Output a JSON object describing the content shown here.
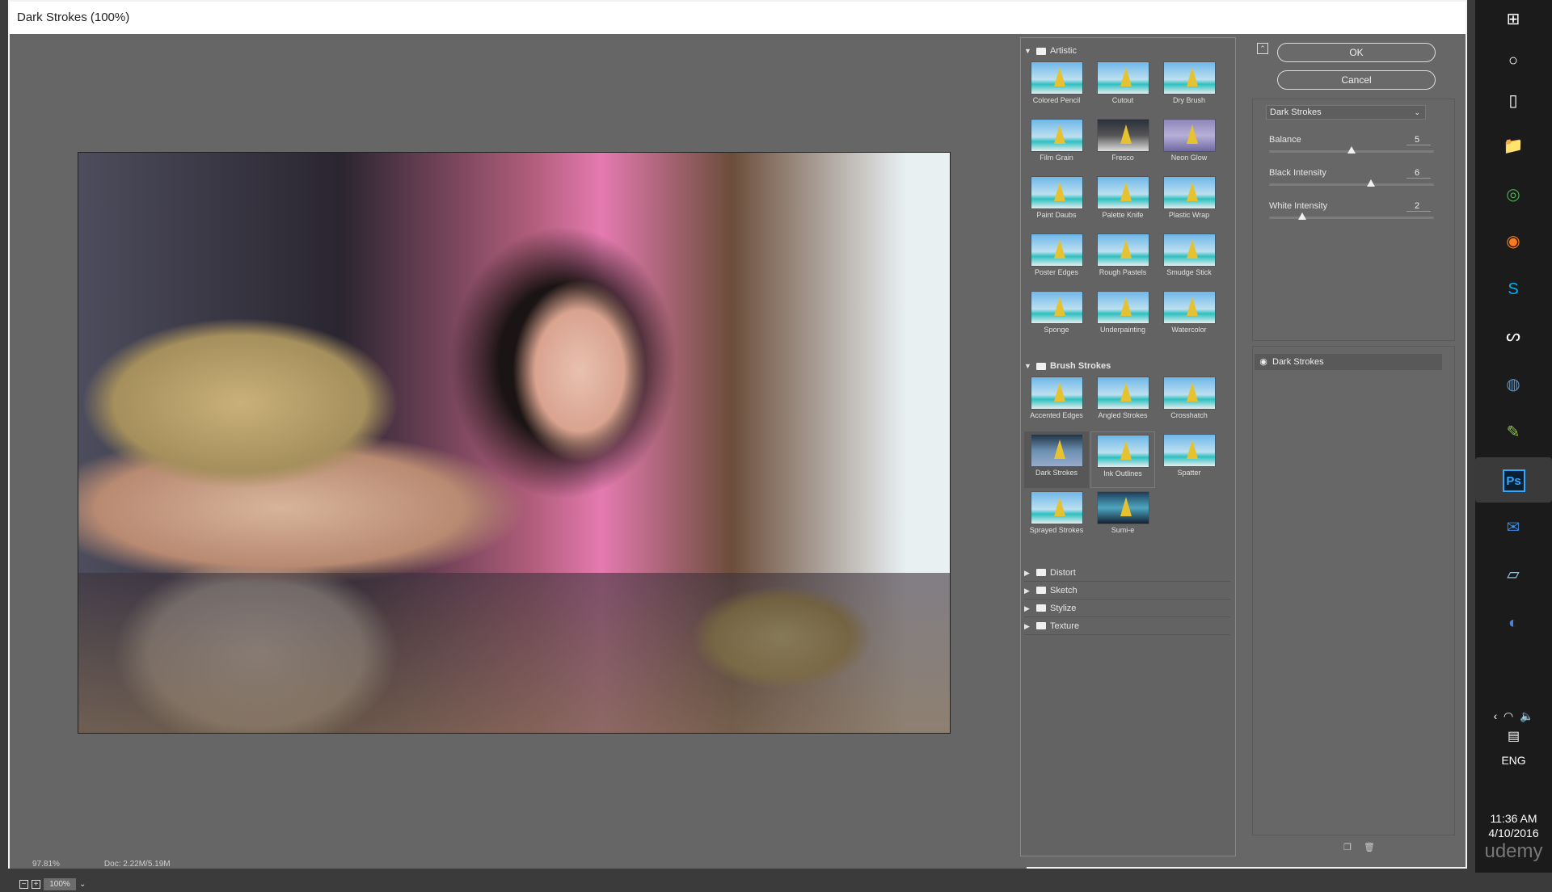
{
  "dialog": {
    "title": "Dark Strokes (100%)"
  },
  "preview": {
    "zoom": "100%",
    "zoom_out": "−",
    "zoom_in": "+",
    "chevron": "⌄"
  },
  "statusbar": {
    "zoom": "97.81%",
    "doc": "Doc: 2.22M/5.19M"
  },
  "gallery": {
    "categories": [
      {
        "name": "Artistic",
        "expanded": true,
        "filters": [
          "Colored Pencil",
          "Cutout",
          "Dry Brush",
          "Film Grain",
          "Fresco",
          "Neon Glow",
          "Paint Daubs",
          "Palette Knife",
          "Plastic Wrap",
          "Poster Edges",
          "Rough Pastels",
          "Smudge Stick",
          "Sponge",
          "Underpainting",
          "Watercolor"
        ]
      },
      {
        "name": "Brush Strokes",
        "expanded": true,
        "filters": [
          "Accented Edges",
          "Angled Strokes",
          "Crosshatch",
          "Dark Strokes",
          "Ink Outlines",
          "Spatter",
          "Sprayed Strokes",
          "Sumi-e"
        ]
      },
      {
        "name": "Distort",
        "expanded": false
      },
      {
        "name": "Sketch",
        "expanded": false
      },
      {
        "name": "Stylize",
        "expanded": false
      },
      {
        "name": "Texture",
        "expanded": false
      }
    ],
    "selected_filter": "Dark Strokes"
  },
  "buttons": {
    "ok": "OK",
    "cancel": "Cancel"
  },
  "settings": {
    "filter": "Dark Strokes",
    "params": [
      {
        "label": "Balance",
        "value": "5",
        "min": 0,
        "max": 10
      },
      {
        "label": "Black Intensity",
        "value": "6",
        "min": 0,
        "max": 10
      },
      {
        "label": "White Intensity",
        "value": "2",
        "min": 0,
        "max": 10
      }
    ]
  },
  "layers": [
    {
      "name": "Dark Strokes",
      "visible": true
    }
  ],
  "taskbar": {
    "icons": [
      "windows-start",
      "cortana",
      "task-view",
      "file-explorer",
      "chrome",
      "firefox",
      "skype",
      "app-swirl",
      "steam",
      "notepad-plus",
      "photoshop",
      "thunderbird",
      "notepad",
      "app-globe"
    ],
    "active": "photoshop",
    "language": "ENG",
    "time": "11:36 AM",
    "date": "4/10/2016",
    "watermark": "udemy"
  },
  "colors": {
    "accent_ps": "#31a8ff",
    "dialog_bg": "#676767"
  }
}
